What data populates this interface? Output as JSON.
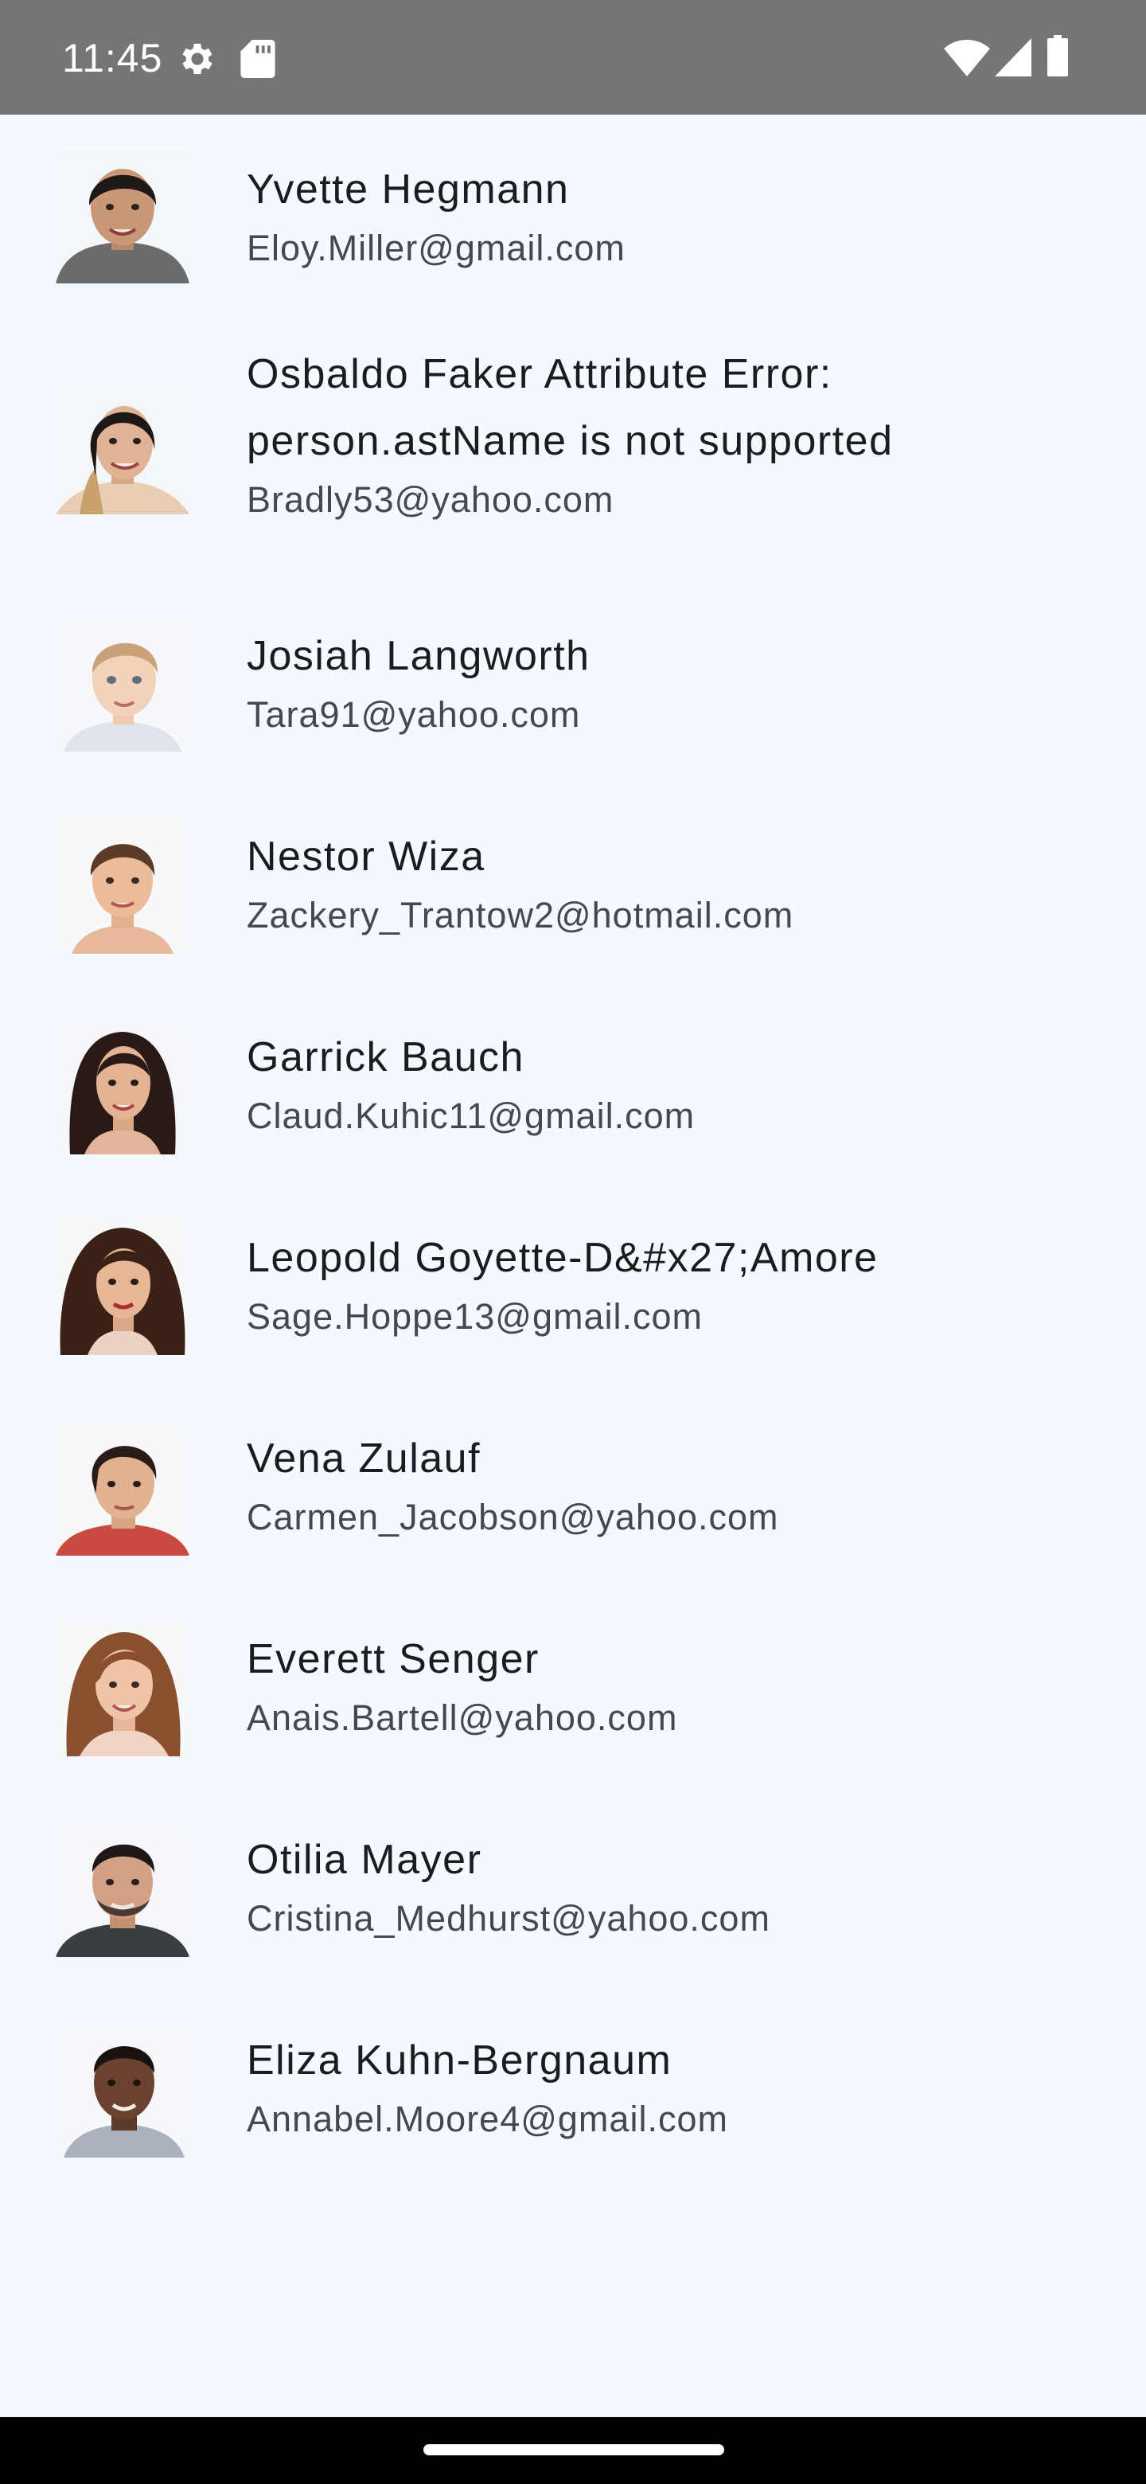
{
  "status_bar": {
    "time": "11:45",
    "left_icons": [
      "settings-gear-icon",
      "sd-card-icon"
    ],
    "right_icons": [
      "wifi-icon",
      "cell-signal-icon",
      "battery-icon"
    ]
  },
  "contacts": [
    {
      "name": "Yvette Hegmann",
      "email": "Eloy.Miller@gmail.com",
      "avatar": "avatar-photo-1"
    },
    {
      "name": "Osbaldo Faker Attribute Error:\nperson.astName is not supported",
      "email": "Bradly53@yahoo.com",
      "avatar": "avatar-photo-2"
    },
    {
      "name": "Josiah Langworth",
      "email": "Tara91@yahoo.com",
      "avatar": "avatar-photo-3"
    },
    {
      "name": "Nestor Wiza",
      "email": "Zackery_Trantow2@hotmail.com",
      "avatar": "avatar-photo-4"
    },
    {
      "name": "Garrick Bauch",
      "email": "Claud.Kuhic11@gmail.com",
      "avatar": "avatar-photo-5"
    },
    {
      "name": "Leopold Goyette-D&#x27;Amore",
      "email": "Sage.Hoppe13@gmail.com",
      "avatar": "avatar-photo-6"
    },
    {
      "name": "Vena Zulauf",
      "email": "Carmen_Jacobson@yahoo.com",
      "avatar": "avatar-photo-7"
    },
    {
      "name": "Everett Senger",
      "email": "Anais.Bartell@yahoo.com",
      "avatar": "avatar-photo-8"
    },
    {
      "name": "Otilia Mayer",
      "email": "Cristina_Medhurst@yahoo.com",
      "avatar": "avatar-photo-9"
    },
    {
      "name": "Eliza Kuhn-Bergnaum",
      "email": "Annabel.Moore4@gmail.com",
      "avatar": "avatar-photo-10"
    }
  ],
  "colors": {
    "background": "#f3f9ff",
    "status_bar": "#757575",
    "name_text": "#1b1c1f",
    "email_text": "#444850",
    "nav_bar": "#000000"
  }
}
